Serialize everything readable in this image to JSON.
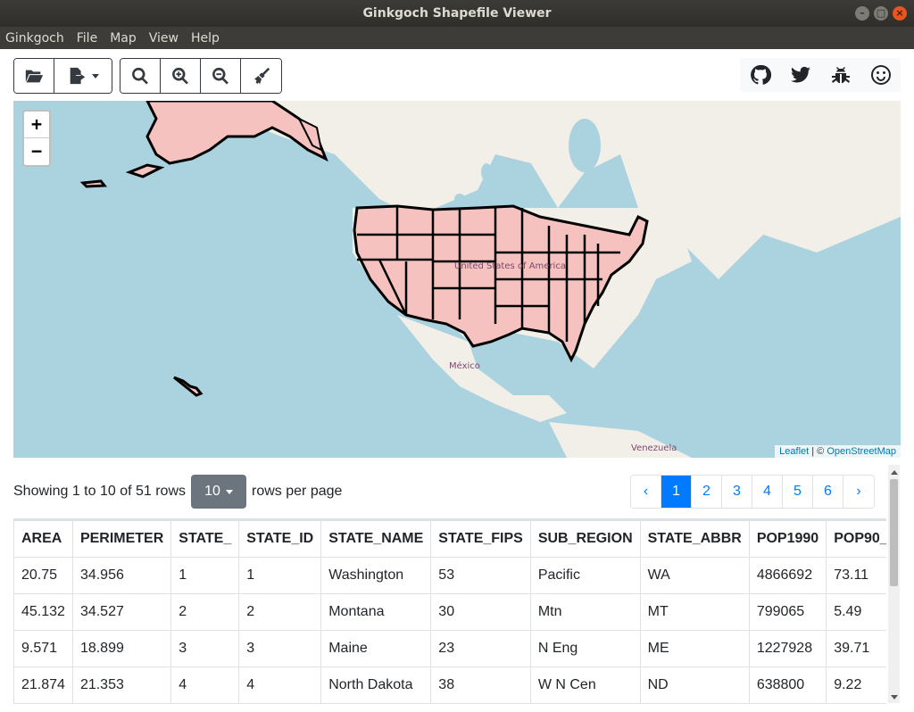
{
  "window": {
    "title": "Ginkgoch Shapefile Viewer"
  },
  "menu": [
    "Ginkgoch",
    "File",
    "Map",
    "View",
    "Help"
  ],
  "toolbar": {
    "file_icons": [
      "folder-open-icon",
      "file-export-icon"
    ],
    "map_icons": [
      "search-icon",
      "zoom-in-icon",
      "zoom-out-icon",
      "broom-icon"
    ],
    "social_icons": [
      "github-icon",
      "twitter-icon",
      "bug-icon",
      "smile-icon"
    ]
  },
  "map": {
    "zoom_in": "+",
    "zoom_out": "−",
    "labels": {
      "usa": "United States of America",
      "mexico": "México",
      "venezuela": "Venezuela"
    },
    "attribution": {
      "leaflet": "Leaflet",
      "sep": " | © ",
      "osm": "OpenStreetMap"
    },
    "feature_fill": "#f5c2bf",
    "feature_stroke": "#000000"
  },
  "table_controls": {
    "showing": "Showing 1 to 10 of 51 rows",
    "rows_per_page_value": "10",
    "rows_per_page_label": "rows per page"
  },
  "pagination": {
    "prev": "‹",
    "pages": [
      "1",
      "2",
      "3",
      "4",
      "5",
      "6"
    ],
    "next": "›",
    "active": "1"
  },
  "table": {
    "columns": [
      "AREA",
      "PERIMETER",
      "STATE_",
      "STATE_ID",
      "STATE_NAME",
      "STATE_FIPS",
      "SUB_REGION",
      "STATE_ABBR",
      "POP1990",
      "POP90_"
    ],
    "rows": [
      [
        "20.75",
        "34.956",
        "1",
        "1",
        "Washington",
        "53",
        "Pacific",
        "WA",
        "4866692",
        "73.11"
      ],
      [
        "45.132",
        "34.527",
        "2",
        "2",
        "Montana",
        "30",
        "Mtn",
        "MT",
        "799065",
        "5.49"
      ],
      [
        "9.571",
        "18.899",
        "3",
        "3",
        "Maine",
        "23",
        "N Eng",
        "ME",
        "1227928",
        "39.71"
      ],
      [
        "21.874",
        "21.353",
        "4",
        "4",
        "North Dakota",
        "38",
        "W N Cen",
        "ND",
        "638800",
        "9.22"
      ]
    ]
  }
}
